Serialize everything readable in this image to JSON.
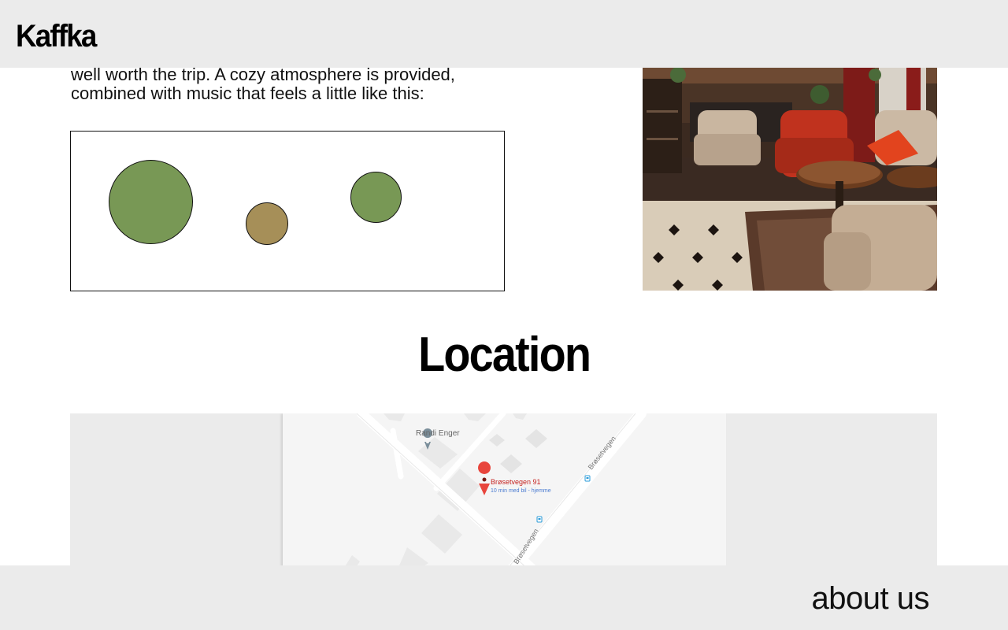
{
  "header": {
    "brand": "Kaffka"
  },
  "intro": {
    "line1": "well worth the trip. A cozy atmosphere is provided,",
    "line2": "combined with music that feels a little like this:"
  },
  "music_visual": {
    "colors": {
      "green": "#789855",
      "tan": "#a68f58"
    }
  },
  "photo": {
    "description_icon": "cafe-interior-photo"
  },
  "location": {
    "title": "Location"
  },
  "map": {
    "place_label": "Randi Enger",
    "marker_title": "Brøsetvegen 91",
    "marker_subtitle": "10 min med bil - hjemme",
    "road_label_1": "Brøsetvegen",
    "road_label_2": "Brøsetvegen",
    "colors": {
      "marker": "#e8453c",
      "marker_text": "#c5221f",
      "subtitle_text": "#4a7bd1",
      "bus_stop": "#2a9bd8"
    }
  },
  "footer": {
    "about_label": "about us"
  }
}
